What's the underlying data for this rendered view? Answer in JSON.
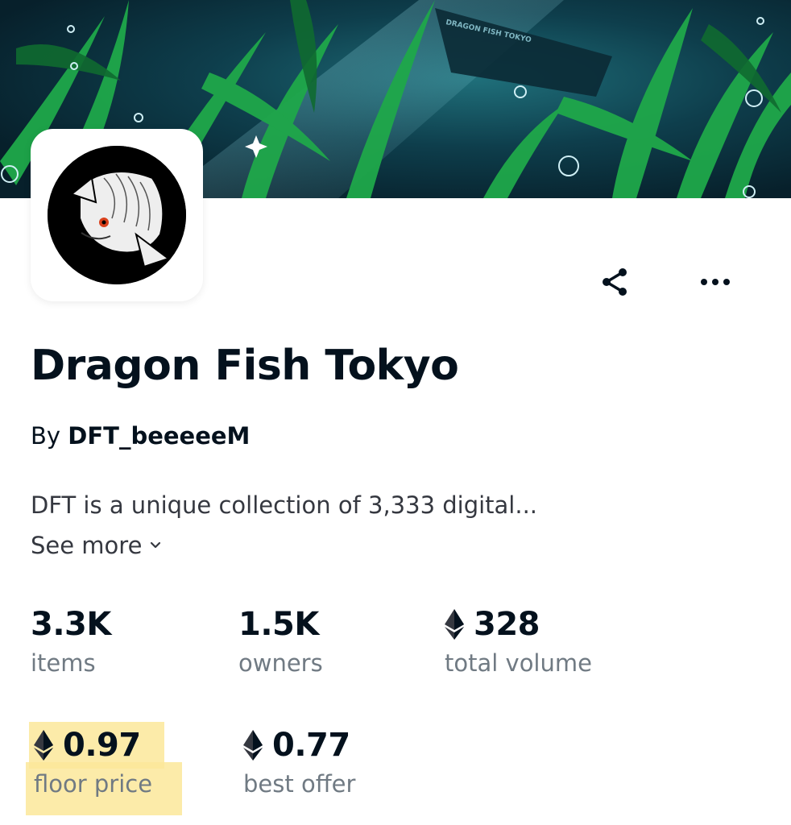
{
  "banner": {
    "ship_text": "DRAGON FISH TOKYO"
  },
  "collection": {
    "title": "Dragon Fish Tokyo",
    "by_prefix": "By",
    "creator": "DFT_beeeeeM",
    "description": "DFT is a unique collection of 3,333 digital...",
    "see_more": "See more"
  },
  "actions": {
    "share_icon": "share-icon",
    "more_icon": "more-horizontal-icon"
  },
  "stats": {
    "items": {
      "value": "3.3K",
      "label": "items"
    },
    "owners": {
      "value": "1.5K",
      "label": "owners"
    },
    "total_volume": {
      "value": "328",
      "label": "total volume",
      "currency_icon": "ethereum-icon"
    },
    "floor_price": {
      "value": "0.97",
      "label": "floor price",
      "currency_icon": "ethereum-icon"
    },
    "best_offer": {
      "value": "0.77",
      "label": "best offer",
      "currency_icon": "ethereum-icon"
    }
  },
  "colors": {
    "text_primary": "#04111d",
    "text_secondary": "#707a83",
    "highlight": "#fbe79a"
  }
}
